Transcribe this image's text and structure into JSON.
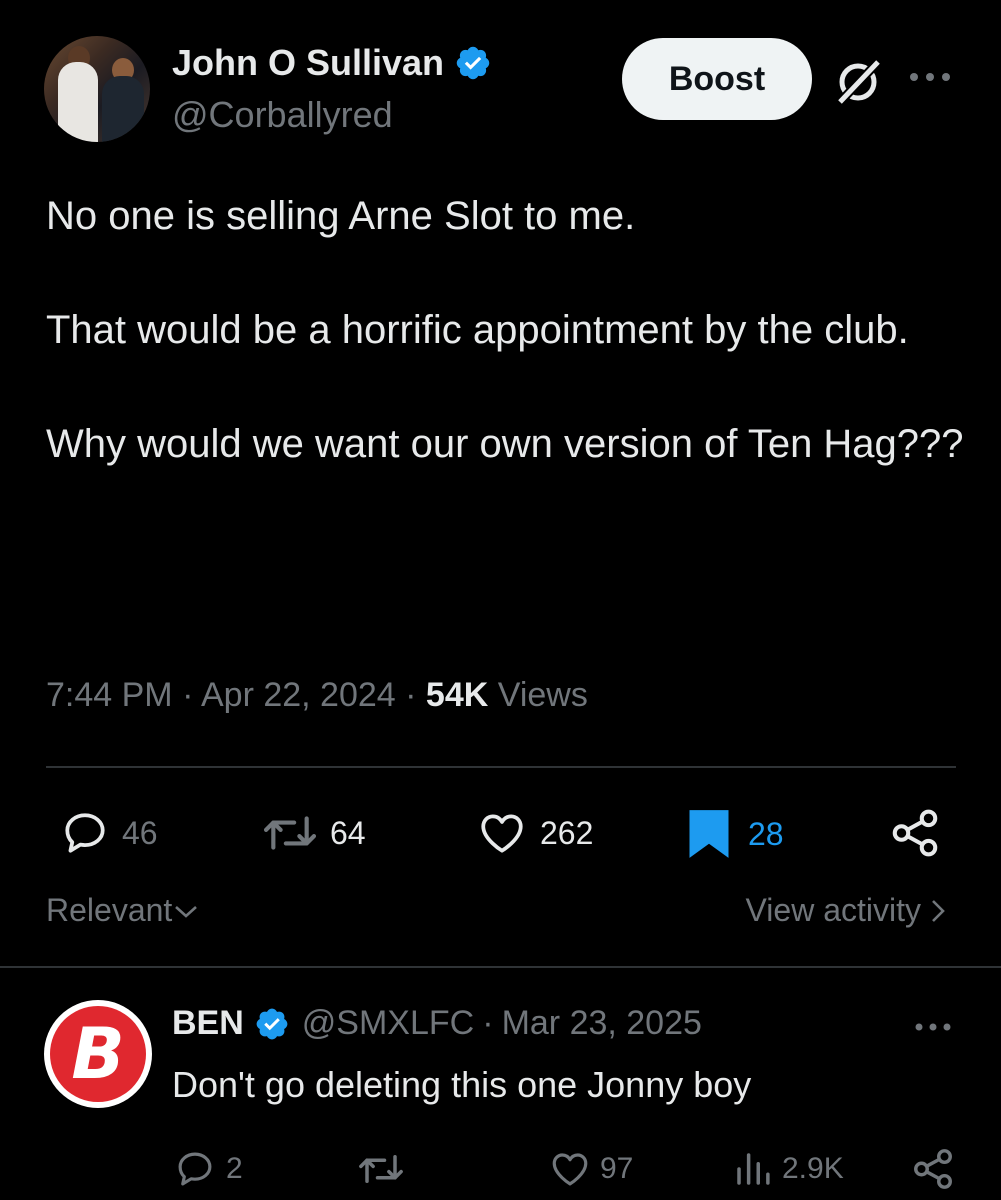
{
  "header": {
    "display_name": "John O Sullivan",
    "handle": "@Corballyred",
    "boost_label": "Boost"
  },
  "tweet": {
    "paragraphs": [
      "No one is selling Arne Slot to me.",
      "That would be a horrific appointment by the club.",
      "Why would we want our own version of Ten Hag???"
    ],
    "time": "7:44 PM",
    "separator": "·",
    "date": "Apr 22, 2024",
    "views_count": "54K",
    "views_label": "Views"
  },
  "actions": {
    "replies": "46",
    "reposts": "64",
    "likes": "262",
    "bookmarks": "28"
  },
  "filters": {
    "relevant_label": "Relevant",
    "view_activity_label": "View activity"
  },
  "reply": {
    "avatar_letter": "B",
    "name": "BEN",
    "handle": "@SMXLFC",
    "separator": "·",
    "date": "Mar 23, 2025",
    "text": "Don't go deleting this one Jonny boy",
    "replies": "2",
    "reposts": "",
    "likes": "97",
    "views": "2.9K"
  },
  "colors": {
    "background": "#000000",
    "text": "#e7e9ea",
    "muted": "#71767b",
    "accent": "#1d9bf0",
    "divider": "#2f3336",
    "brand_red": "#e0282f"
  },
  "icons": [
    "verified-badge-icon",
    "grok-icon",
    "more-icon",
    "reply-icon",
    "repost-icon",
    "like-icon",
    "bookmark-icon",
    "share-icon",
    "views-icon",
    "chevron-down-icon",
    "chevron-right-icon"
  ]
}
